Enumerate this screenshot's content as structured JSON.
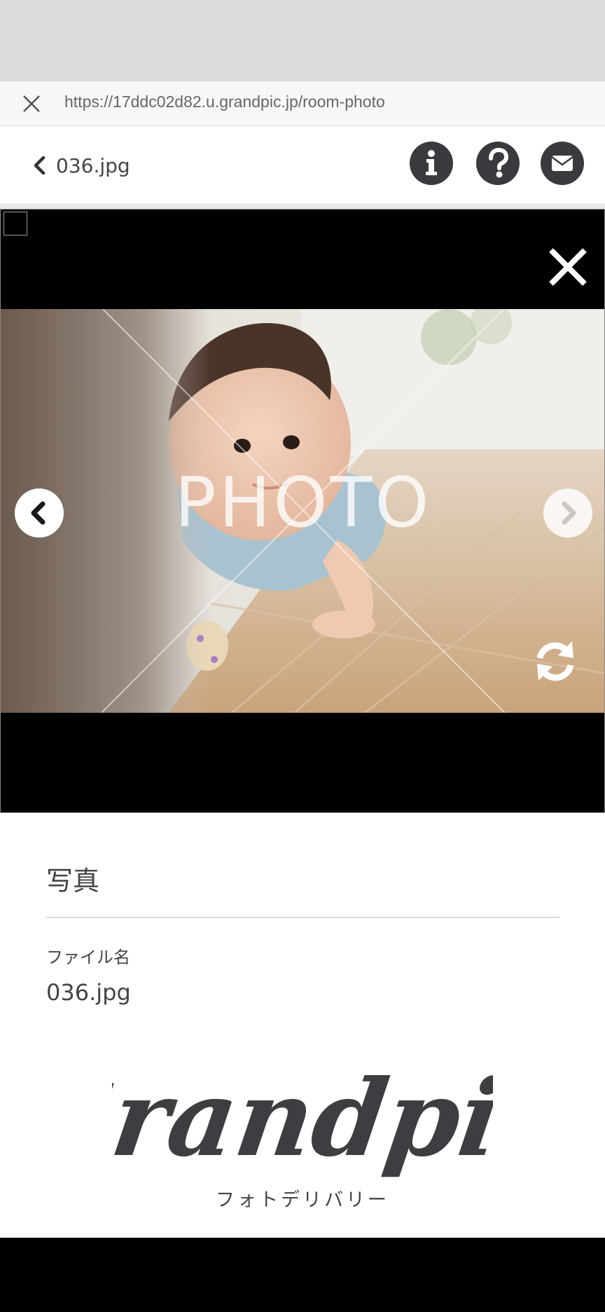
{
  "browser": {
    "url": "https://17ddc02d82.u.grandpic.jp/room-photo"
  },
  "header": {
    "filename": "036.jpg"
  },
  "viewer": {
    "watermark": "PHOTO"
  },
  "info": {
    "section_title": "写真",
    "file_label": "ファイル名",
    "file_value": "036.jpg"
  },
  "brand": {
    "logo_text": "Grandpic",
    "tagline": "フォトデリバリー"
  },
  "colors": {
    "icon_dark": "#3a3a3e",
    "viewer_bg": "#000000"
  }
}
